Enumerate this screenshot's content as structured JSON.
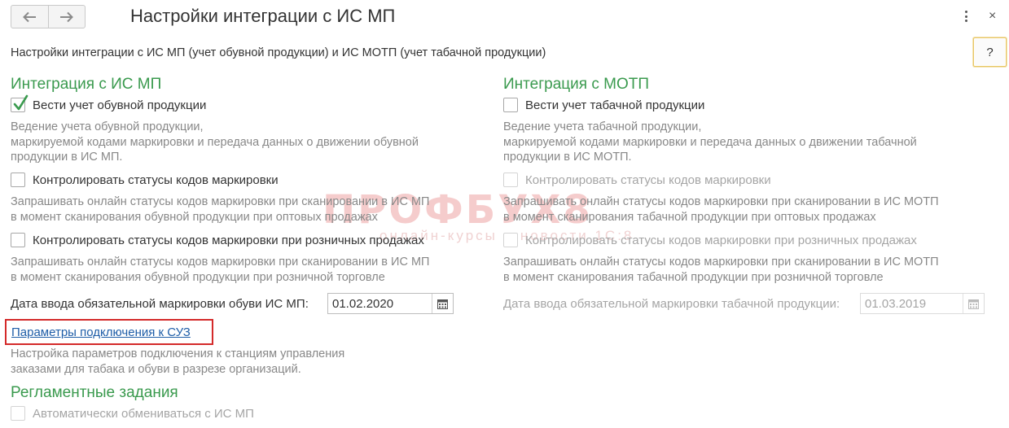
{
  "window": {
    "title": "Настройки интеграции с ИС МП",
    "subtitle": "Настройки интеграции с ИС МП (учет обувной продукции) и ИС МОТП (учет табачной продукции)",
    "help_label": "?",
    "close_label": "×"
  },
  "left": {
    "section_title": "Интеграция с ИС МП",
    "shoes_check": {
      "label": "Вести учет обувной продукции",
      "checked": true
    },
    "shoes_desc": [
      "Ведение учета обувной продукции,",
      "маркируемой кодами маркировки и передача данных о движении обувной",
      "продукции в ИС МП."
    ],
    "status_check": {
      "label": "Контролировать статусы кодов маркировки",
      "checked": false
    },
    "status_desc": [
      "Запрашивать онлайн статусы кодов маркировки при сканировании в ИС МП",
      "в момент сканирования обувной продукции при оптовых продажах"
    ],
    "retail_check": {
      "label": "Контролировать статусы кодов маркировки при розничных продажах",
      "checked": false
    },
    "retail_desc": [
      "Запрашивать онлайн статусы кодов маркировки при сканировании в ИС МП",
      "в момент сканирования обувной продукции при розничной торговле"
    ],
    "date_label": "Дата ввода обязательной маркировки обуви ИС МП:",
    "date_value": "01.02.2020",
    "link_label": "Параметры подключения к СУЗ",
    "link_desc": [
      "Настройка параметров подключения к станциям управления",
      "заказами для табака и обуви в разрезе организаций."
    ]
  },
  "right": {
    "section_title": "Интеграция с МОТП",
    "tobacco_check": {
      "label": "Вести учет табачной продукции",
      "checked": false
    },
    "tobacco_desc": [
      "Ведение учета табачной продукции,",
      "маркируемой кодами маркировки и передача данных о движении табачной",
      "продукции в ИС МОТП."
    ],
    "status_check": {
      "label": "Контролировать статусы кодов маркировки",
      "checked": false
    },
    "status_desc": [
      "Запрашивать онлайн статусы кодов маркировки при сканировании в ИС МОТП",
      "в момент сканирования табачной продукции при оптовых продажах"
    ],
    "retail_check": {
      "label": "Контролировать статусы кодов маркировки при розничных продажах",
      "checked": false
    },
    "retail_desc": [
      "Запрашивать онлайн статусы кодов маркировки при сканировании в ИС МОТП",
      "в момент сканирования табачной продукции при розничной торговле"
    ],
    "date_label": "Дата ввода обязательной маркировки табачной продукции:",
    "date_value": "01.03.2019"
  },
  "scheduled": {
    "section_title": "Регламентные задания",
    "auto_check": {
      "label": "Автоматически обмениваться с ИС МП",
      "checked": false
    }
  },
  "watermark": {
    "logo": "ПРОФБУХ8",
    "sub": "онлайн-курсы и новости 1С:8"
  },
  "colors": {
    "section_title": "#3a9a4e",
    "link": "#1f5ea8",
    "highlight": "#d42a2a",
    "check": "#3a9a4e",
    "desc": "#888888"
  }
}
